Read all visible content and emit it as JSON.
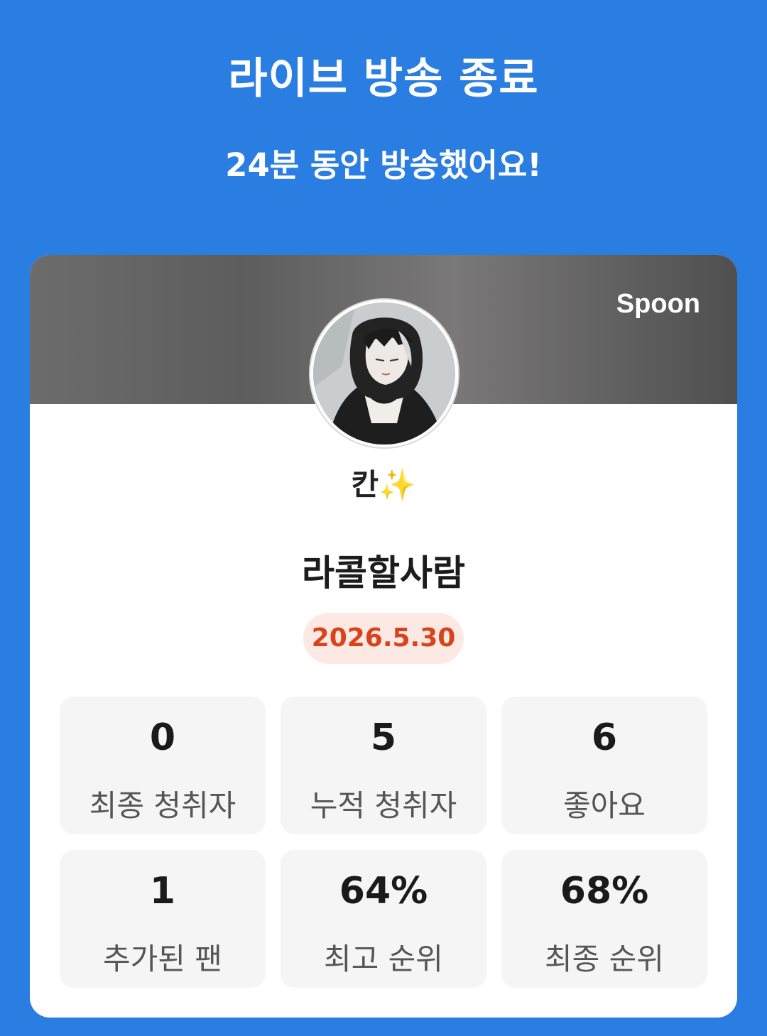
{
  "header": {
    "title": "라이브 방송 종료",
    "subtitle": "24분 동안 방송했어요!"
  },
  "card": {
    "brand": "Spoon",
    "nickname": "칸✨",
    "room_title": "라콜할사람",
    "date": "2026.5.30",
    "stats": [
      {
        "value": "0",
        "label": "최종 청취자"
      },
      {
        "value": "5",
        "label": "누적 청취자"
      },
      {
        "value": "6",
        "label": "좋아요"
      },
      {
        "value": "1",
        "label": "추가된 팬"
      },
      {
        "value": "64%",
        "label": "최고 순위"
      },
      {
        "value": "68%",
        "label": "최종 순위"
      }
    ]
  },
  "colors": {
    "background": "#2a7de1",
    "date_text": "#d8431b",
    "date_badge_bg": "#fde9e3"
  }
}
